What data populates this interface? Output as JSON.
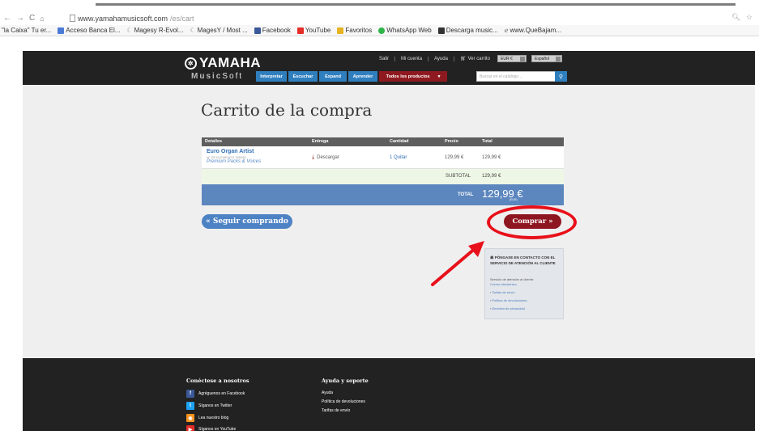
{
  "browser": {
    "url_host": "www.yamahamusicsoft.com",
    "url_path": "/es/cart",
    "bookmarks": [
      {
        "label": "\"la Caixa\" Tu er...",
        "icon": "bookmark-icon",
        "color": "#1a5aa8"
      },
      {
        "label": "Acceso Banca El...",
        "icon": "bank-icon",
        "color": "#4a7bd8"
      },
      {
        "label": "Magesy R-Evol...",
        "icon": "magesy-icon",
        "color": "#888888"
      },
      {
        "label": "MagesY / Most ...",
        "icon": "magesy-icon",
        "color": "#888888"
      },
      {
        "label": "Facebook",
        "icon": "facebook-icon",
        "color": "#3b5998"
      },
      {
        "label": "YouTube",
        "icon": "youtube-icon",
        "color": "#e52d27"
      },
      {
        "label": "Favoritos",
        "icon": "folder-icon",
        "color": "#e6b422"
      },
      {
        "label": "WhatsApp Web",
        "icon": "whatsapp-icon",
        "color": "#2fb44a"
      },
      {
        "label": "Descarga music...",
        "icon": "download-icon",
        "color": "#333333"
      },
      {
        "label": "www.QueBajam...",
        "icon": "link-icon",
        "color": "#666666"
      }
    ]
  },
  "header": {
    "logo_text": "YAMAHA",
    "musicsoft_music": "Music",
    "musicsoft_soft": "Soft",
    "top_links": {
      "salir": "Salir",
      "mi_cuenta": "Mi cuenta",
      "ayuda": "Ayuda",
      "ver_carrito": "Ver carrito"
    },
    "currency_select": "EUR €",
    "language_select": "Español",
    "nav": {
      "interpretar": "Interpretar",
      "escuchar": "Escuchar",
      "expand": "Expand",
      "aprender": "Aprender",
      "todos": "Todos los productos"
    },
    "search_placeholder": "Buscar en el catálogo..."
  },
  "page": {
    "title": "Carrito de la compra"
  },
  "cart": {
    "columns": {
      "detalles": "Detalles",
      "entrega": "Entrega",
      "cantidad": "Cantidad",
      "precio": "Precio",
      "total": "Total"
    },
    "item": {
      "name": "Euro Organ Artist",
      "sub": "N° DE ELEMENTO 788493",
      "line": "Premium Packs & Voices",
      "delivery": "Descargar",
      "quantity": "1 Quitar",
      "price": "129,99 €",
      "total": "129,99 €"
    },
    "subtotal_label": "SUBTOTAL",
    "subtotal_value": "129,99 €",
    "total_label": "TOTAL",
    "total_value": "129,99 €",
    "total_currency": "(EUR)"
  },
  "buttons": {
    "seguir": "« Seguir comprando",
    "comprar": "Comprar »"
  },
  "contact": {
    "title": "PÓNGASE EN CONTACTO CON EL SERVICIO DE ATENCIÓN AL CLIENTE",
    "service_text": "Servicio de atención al cliente:",
    "email_link": "Correo electrónico",
    "links": [
      "Tarifas de envío",
      "Política de devoluciones",
      "Directiva de privacidad"
    ]
  },
  "footer": {
    "connect_title": "Conéctese a nosotros",
    "social": [
      {
        "label": "Agréguenos en Facebook",
        "icon": "facebook-icon",
        "color": "#3b5998"
      },
      {
        "label": "Síganos en Twitter",
        "icon": "twitter-icon",
        "color": "#1da1f2"
      },
      {
        "label": "Lea nuestro blog",
        "icon": "blog-icon",
        "color": "#f7931e"
      },
      {
        "label": "Síganos en YouTube",
        "icon": "youtube-icon",
        "color": "#e52d27"
      }
    ],
    "help_title": "Ayuda y soporte",
    "help_links": [
      "Ayuda",
      "Política de devoluciones",
      "Tarifas de envío"
    ]
  },
  "colors": {
    "accent_blue": "#4d82c4",
    "buy_button": "#8e1620",
    "highlight": "#e8101a"
  }
}
